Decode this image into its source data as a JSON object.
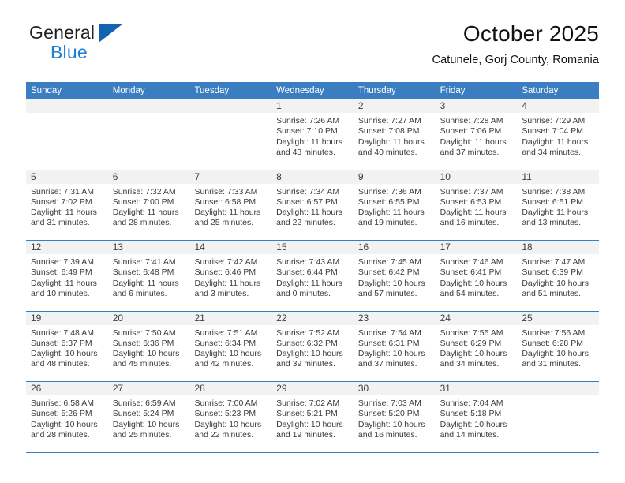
{
  "brand": {
    "name_top": "General",
    "name_bottom": "Blue",
    "accent_color": "#1b7fd4",
    "triangle_color": "#1263b0"
  },
  "header": {
    "month_title": "October 2025",
    "location": "Catunele, Gorj County, Romania"
  },
  "calendar": {
    "header_background": "#3a7dc0",
    "day_band_background": "#f2f2f2",
    "weekdays": [
      "Sunday",
      "Monday",
      "Tuesday",
      "Wednesday",
      "Thursday",
      "Friday",
      "Saturday"
    ],
    "weeks": [
      [
        {
          "number": "",
          "sunrise": "",
          "sunset": "",
          "daylight_1": "",
          "daylight_2": "",
          "empty": true
        },
        {
          "number": "",
          "sunrise": "",
          "sunset": "",
          "daylight_1": "",
          "daylight_2": "",
          "empty": true
        },
        {
          "number": "",
          "sunrise": "",
          "sunset": "",
          "daylight_1": "",
          "daylight_2": "",
          "empty": true
        },
        {
          "number": "1",
          "sunrise": "Sunrise: 7:26 AM",
          "sunset": "Sunset: 7:10 PM",
          "daylight_1": "Daylight: 11 hours",
          "daylight_2": "and 43 minutes."
        },
        {
          "number": "2",
          "sunrise": "Sunrise: 7:27 AM",
          "sunset": "Sunset: 7:08 PM",
          "daylight_1": "Daylight: 11 hours",
          "daylight_2": "and 40 minutes."
        },
        {
          "number": "3",
          "sunrise": "Sunrise: 7:28 AM",
          "sunset": "Sunset: 7:06 PM",
          "daylight_1": "Daylight: 11 hours",
          "daylight_2": "and 37 minutes."
        },
        {
          "number": "4",
          "sunrise": "Sunrise: 7:29 AM",
          "sunset": "Sunset: 7:04 PM",
          "daylight_1": "Daylight: 11 hours",
          "daylight_2": "and 34 minutes."
        }
      ],
      [
        {
          "number": "5",
          "sunrise": "Sunrise: 7:31 AM",
          "sunset": "Sunset: 7:02 PM",
          "daylight_1": "Daylight: 11 hours",
          "daylight_2": "and 31 minutes."
        },
        {
          "number": "6",
          "sunrise": "Sunrise: 7:32 AM",
          "sunset": "Sunset: 7:00 PM",
          "daylight_1": "Daylight: 11 hours",
          "daylight_2": "and 28 minutes."
        },
        {
          "number": "7",
          "sunrise": "Sunrise: 7:33 AM",
          "sunset": "Sunset: 6:58 PM",
          "daylight_1": "Daylight: 11 hours",
          "daylight_2": "and 25 minutes."
        },
        {
          "number": "8",
          "sunrise": "Sunrise: 7:34 AM",
          "sunset": "Sunset: 6:57 PM",
          "daylight_1": "Daylight: 11 hours",
          "daylight_2": "and 22 minutes."
        },
        {
          "number": "9",
          "sunrise": "Sunrise: 7:36 AM",
          "sunset": "Sunset: 6:55 PM",
          "daylight_1": "Daylight: 11 hours",
          "daylight_2": "and 19 minutes."
        },
        {
          "number": "10",
          "sunrise": "Sunrise: 7:37 AM",
          "sunset": "Sunset: 6:53 PM",
          "daylight_1": "Daylight: 11 hours",
          "daylight_2": "and 16 minutes."
        },
        {
          "number": "11",
          "sunrise": "Sunrise: 7:38 AM",
          "sunset": "Sunset: 6:51 PM",
          "daylight_1": "Daylight: 11 hours",
          "daylight_2": "and 13 minutes."
        }
      ],
      [
        {
          "number": "12",
          "sunrise": "Sunrise: 7:39 AM",
          "sunset": "Sunset: 6:49 PM",
          "daylight_1": "Daylight: 11 hours",
          "daylight_2": "and 10 minutes."
        },
        {
          "number": "13",
          "sunrise": "Sunrise: 7:41 AM",
          "sunset": "Sunset: 6:48 PM",
          "daylight_1": "Daylight: 11 hours",
          "daylight_2": "and 6 minutes."
        },
        {
          "number": "14",
          "sunrise": "Sunrise: 7:42 AM",
          "sunset": "Sunset: 6:46 PM",
          "daylight_1": "Daylight: 11 hours",
          "daylight_2": "and 3 minutes."
        },
        {
          "number": "15",
          "sunrise": "Sunrise: 7:43 AM",
          "sunset": "Sunset: 6:44 PM",
          "daylight_1": "Daylight: 11 hours",
          "daylight_2": "and 0 minutes."
        },
        {
          "number": "16",
          "sunrise": "Sunrise: 7:45 AM",
          "sunset": "Sunset: 6:42 PM",
          "daylight_1": "Daylight: 10 hours",
          "daylight_2": "and 57 minutes."
        },
        {
          "number": "17",
          "sunrise": "Sunrise: 7:46 AM",
          "sunset": "Sunset: 6:41 PM",
          "daylight_1": "Daylight: 10 hours",
          "daylight_2": "and 54 minutes."
        },
        {
          "number": "18",
          "sunrise": "Sunrise: 7:47 AM",
          "sunset": "Sunset: 6:39 PM",
          "daylight_1": "Daylight: 10 hours",
          "daylight_2": "and 51 minutes."
        }
      ],
      [
        {
          "number": "19",
          "sunrise": "Sunrise: 7:48 AM",
          "sunset": "Sunset: 6:37 PM",
          "daylight_1": "Daylight: 10 hours",
          "daylight_2": "and 48 minutes."
        },
        {
          "number": "20",
          "sunrise": "Sunrise: 7:50 AM",
          "sunset": "Sunset: 6:36 PM",
          "daylight_1": "Daylight: 10 hours",
          "daylight_2": "and 45 minutes."
        },
        {
          "number": "21",
          "sunrise": "Sunrise: 7:51 AM",
          "sunset": "Sunset: 6:34 PM",
          "daylight_1": "Daylight: 10 hours",
          "daylight_2": "and 42 minutes."
        },
        {
          "number": "22",
          "sunrise": "Sunrise: 7:52 AM",
          "sunset": "Sunset: 6:32 PM",
          "daylight_1": "Daylight: 10 hours",
          "daylight_2": "and 39 minutes."
        },
        {
          "number": "23",
          "sunrise": "Sunrise: 7:54 AM",
          "sunset": "Sunset: 6:31 PM",
          "daylight_1": "Daylight: 10 hours",
          "daylight_2": "and 37 minutes."
        },
        {
          "number": "24",
          "sunrise": "Sunrise: 7:55 AM",
          "sunset": "Sunset: 6:29 PM",
          "daylight_1": "Daylight: 10 hours",
          "daylight_2": "and 34 minutes."
        },
        {
          "number": "25",
          "sunrise": "Sunrise: 7:56 AM",
          "sunset": "Sunset: 6:28 PM",
          "daylight_1": "Daylight: 10 hours",
          "daylight_2": "and 31 minutes."
        }
      ],
      [
        {
          "number": "26",
          "sunrise": "Sunrise: 6:58 AM",
          "sunset": "Sunset: 5:26 PM",
          "daylight_1": "Daylight: 10 hours",
          "daylight_2": "and 28 minutes."
        },
        {
          "number": "27",
          "sunrise": "Sunrise: 6:59 AM",
          "sunset": "Sunset: 5:24 PM",
          "daylight_1": "Daylight: 10 hours",
          "daylight_2": "and 25 minutes."
        },
        {
          "number": "28",
          "sunrise": "Sunrise: 7:00 AM",
          "sunset": "Sunset: 5:23 PM",
          "daylight_1": "Daylight: 10 hours",
          "daylight_2": "and 22 minutes."
        },
        {
          "number": "29",
          "sunrise": "Sunrise: 7:02 AM",
          "sunset": "Sunset: 5:21 PM",
          "daylight_1": "Daylight: 10 hours",
          "daylight_2": "and 19 minutes."
        },
        {
          "number": "30",
          "sunrise": "Sunrise: 7:03 AM",
          "sunset": "Sunset: 5:20 PM",
          "daylight_1": "Daylight: 10 hours",
          "daylight_2": "and 16 minutes."
        },
        {
          "number": "31",
          "sunrise": "Sunrise: 7:04 AM",
          "sunset": "Sunset: 5:18 PM",
          "daylight_1": "Daylight: 10 hours",
          "daylight_2": "and 14 minutes."
        },
        {
          "number": "",
          "sunrise": "",
          "sunset": "",
          "daylight_1": "",
          "daylight_2": "",
          "empty": true
        }
      ]
    ]
  }
}
